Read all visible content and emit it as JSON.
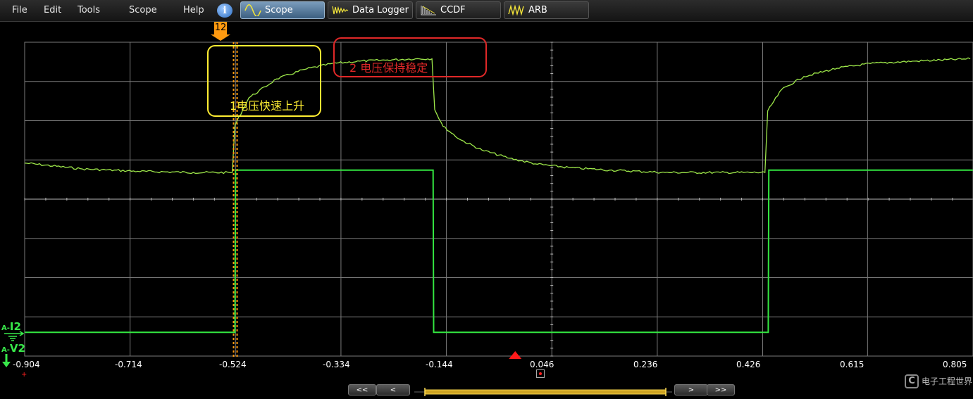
{
  "menu": {
    "items": [
      "File",
      "Edit",
      "Tools",
      "Scope",
      "Help"
    ]
  },
  "tabs": [
    {
      "label": "Scope",
      "active": true
    },
    {
      "label": "Data Logger",
      "active": false
    },
    {
      "label": "CCDF",
      "active": false
    },
    {
      "label": "ARB",
      "active": false
    }
  ],
  "colors": {
    "trace": "#9ee84a",
    "trace2": "#33e640",
    "grid": "#7a7a7a",
    "cursor": "#ff9a10",
    "annotation_yellow": "#ffee33",
    "annotation_red": "#e02828",
    "trigger": "#ff1a1a"
  },
  "marker": {
    "label": "12"
  },
  "x_axis": {
    "ticks": [
      "-0.904",
      "-0.714",
      "-0.524",
      "-0.334",
      "-0.144",
      "0.046",
      "0.236",
      "0.426",
      "0.615",
      "0.805"
    ]
  },
  "traces": {
    "current_tag_prefix": "A-",
    "current_tag": "I2",
    "voltage_tag_prefix": "A-",
    "voltage_tag": "V2"
  },
  "annotations": {
    "rise": "1电压快速上升",
    "stable": "2 电压保持稳定"
  },
  "navigation": {
    "prev_all": "<<",
    "prev": "<",
    "next": ">",
    "next_all": ">>"
  },
  "watermark": {
    "text": "电子工程世界"
  },
  "chart_data": {
    "type": "line",
    "x_ticks": [
      -0.904,
      -0.714,
      -0.524,
      -0.334,
      -0.144,
      0.046,
      0.236,
      0.426,
      0.615,
      0.805
    ],
    "xlim": [
      -0.904,
      0.805
    ],
    "series": [
      {
        "name": "V2",
        "x": [
          -0.904,
          -0.8,
          -0.7,
          -0.6,
          -0.53,
          -0.525,
          -0.5,
          -0.45,
          -0.4,
          -0.35,
          -0.3,
          -0.25,
          -0.2,
          -0.17,
          -0.165,
          -0.15,
          -0.12,
          -0.08,
          -0.03,
          0.02,
          0.08,
          0.15,
          0.25,
          0.35,
          0.43,
          0.435,
          0.46,
          0.5,
          0.56,
          0.62,
          0.7,
          0.8
        ],
        "y": [
          0.53,
          0.48,
          0.46,
          0.45,
          0.45,
          0.85,
          1.08,
          1.24,
          1.32,
          1.37,
          1.39,
          1.4,
          1.41,
          1.41,
          0.98,
          0.84,
          0.73,
          0.64,
          0.57,
          0.52,
          0.49,
          0.47,
          0.45,
          0.45,
          0.45,
          0.97,
          1.15,
          1.26,
          1.33,
          1.37,
          1.39,
          1.41
        ]
      },
      {
        "name": "I2",
        "x": [
          -0.904,
          -0.525,
          -0.524,
          -0.168,
          -0.167,
          0.436,
          0.437,
          0.805
        ],
        "y": [
          -0.9,
          -0.9,
          0.47,
          0.47,
          -0.9,
          -0.9,
          0.47,
          0.47
        ]
      }
    ]
  }
}
